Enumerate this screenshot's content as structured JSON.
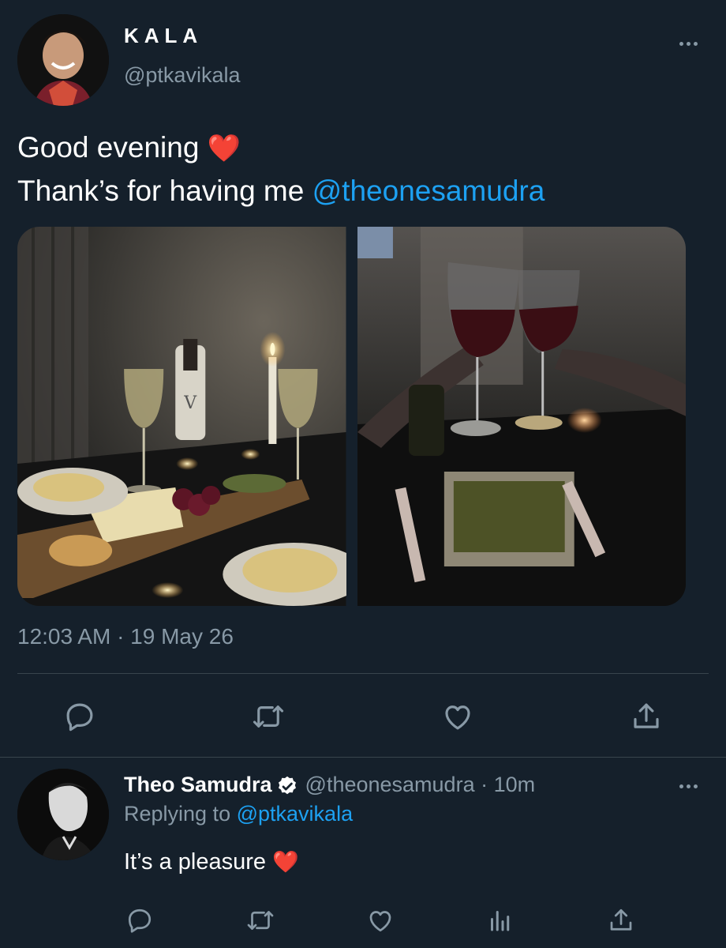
{
  "main_tweet": {
    "display_name": "KALA",
    "handle": "@ptkavikala",
    "text_line1": "Good evening",
    "text_line1_emoji": "❤️",
    "text_line2_prefix": "Thank’s for having me",
    "text_line2_mention": "@theonesamudra",
    "timestamp": "12:03 AM · 19 May 26",
    "media": [
      "photo-dinner-table",
      "photo-wine-toast"
    ]
  },
  "reply": {
    "display_name": "Theo Samudra",
    "verified": true,
    "handle": "@theonesamudra",
    "separator": "·",
    "time": "10m",
    "replying_prefix": "Replying to",
    "replying_mention": "@ptkavikala",
    "text": "It’s a pleasure",
    "text_emoji": "❤️"
  },
  "icons": {
    "reply": "reply-icon",
    "retweet": "retweet-icon",
    "like": "like-icon",
    "share": "share-icon",
    "analytics": "analytics-icon",
    "more": "more-icon",
    "verified": "verified-badge-icon"
  },
  "colors": {
    "background": "#15202b",
    "text_secondary": "#8899a6",
    "link": "#1da1f2",
    "divider": "#38444d",
    "heart": "#e0245e"
  }
}
